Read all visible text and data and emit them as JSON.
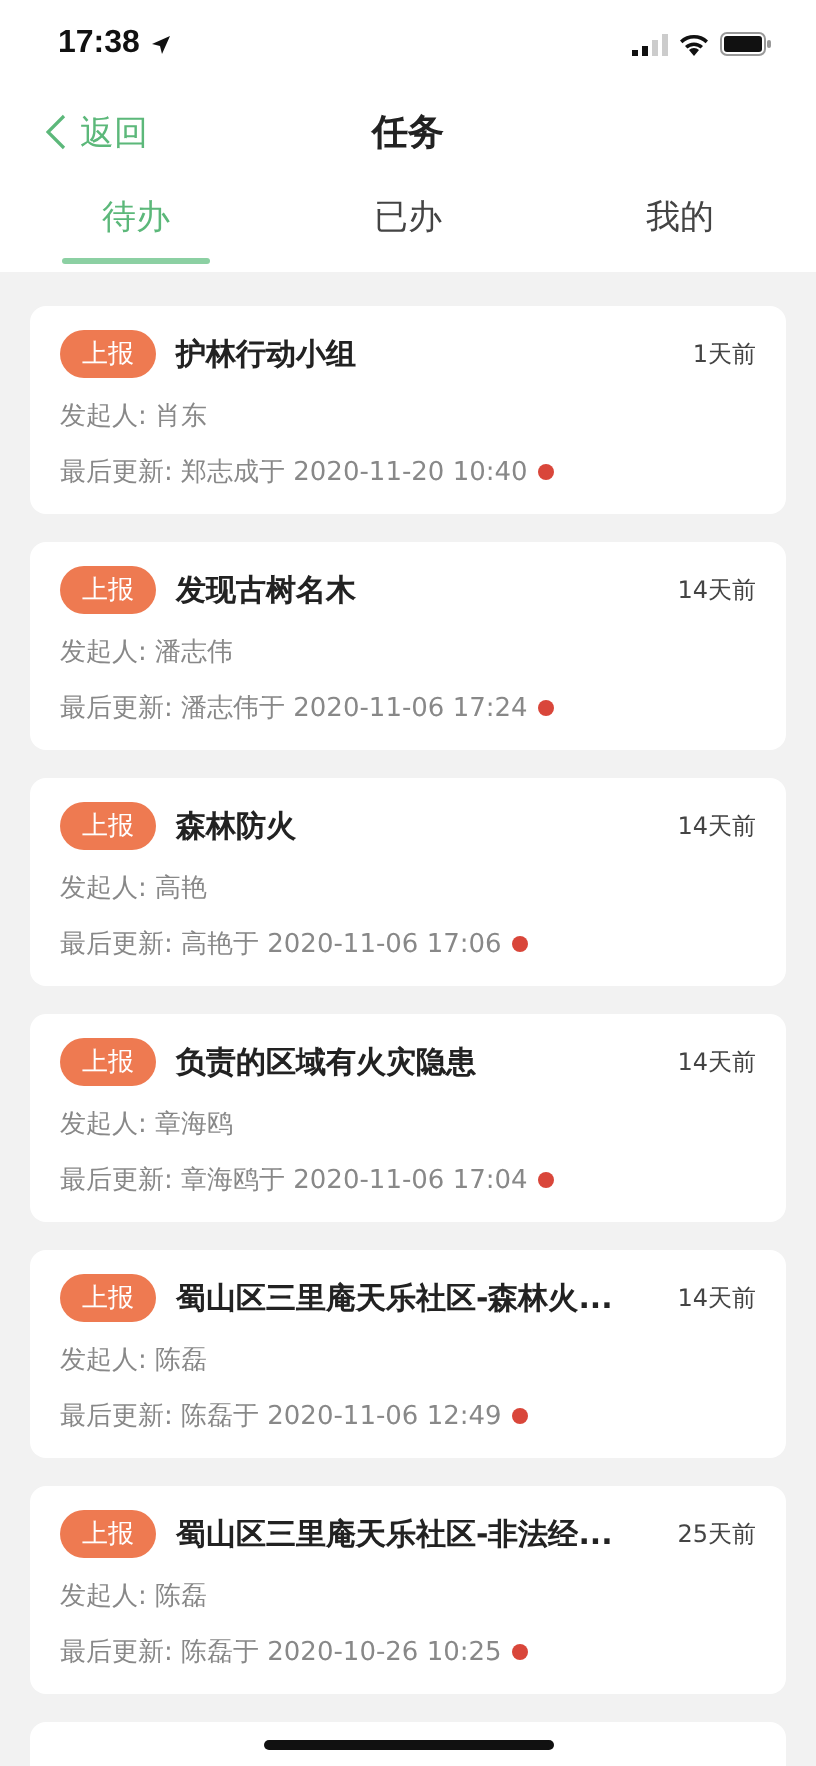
{
  "status_bar": {
    "time": "17:38"
  },
  "nav": {
    "back": "返回",
    "title": "任务"
  },
  "tabs": [
    {
      "label": "待办",
      "selected": true
    },
    {
      "label": "已办",
      "selected": false
    },
    {
      "label": "我的",
      "selected": false
    }
  ],
  "tasks": [
    {
      "tag": "上报",
      "title": "护林行动小组",
      "age": "1天前",
      "initiator": "发起人: 肖东",
      "updated": "最后更新: 郑志成于 2020-11-20 10:40",
      "unread": true
    },
    {
      "tag": "上报",
      "title": "发现古树名木",
      "age": "14天前",
      "initiator": "发起人: 潘志伟",
      "updated": "最后更新: 潘志伟于 2020-11-06 17:24",
      "unread": true
    },
    {
      "tag": "上报",
      "title": "森林防火",
      "age": "14天前",
      "initiator": "发起人: 高艳",
      "updated": "最后更新: 高艳于 2020-11-06 17:06",
      "unread": true
    },
    {
      "tag": "上报",
      "title": "负责的区域有火灾隐患",
      "age": "14天前",
      "initiator": "发起人: 章海鸥",
      "updated": "最后更新: 章海鸥于 2020-11-06 17:04",
      "unread": true
    },
    {
      "tag": "上报",
      "title": "蜀山区三里庵天乐社区-森林火...",
      "age": "14天前",
      "initiator": "发起人: 陈磊",
      "updated": "最后更新: 陈磊于 2020-11-06 12:49",
      "unread": true
    },
    {
      "tag": "上报",
      "title": "蜀山区三里庵天乐社区-非法经...",
      "age": "25天前",
      "initiator": "发起人: 陈磊",
      "updated": "最后更新: 陈磊于 2020-10-26 10:25",
      "unread": true
    }
  ]
}
